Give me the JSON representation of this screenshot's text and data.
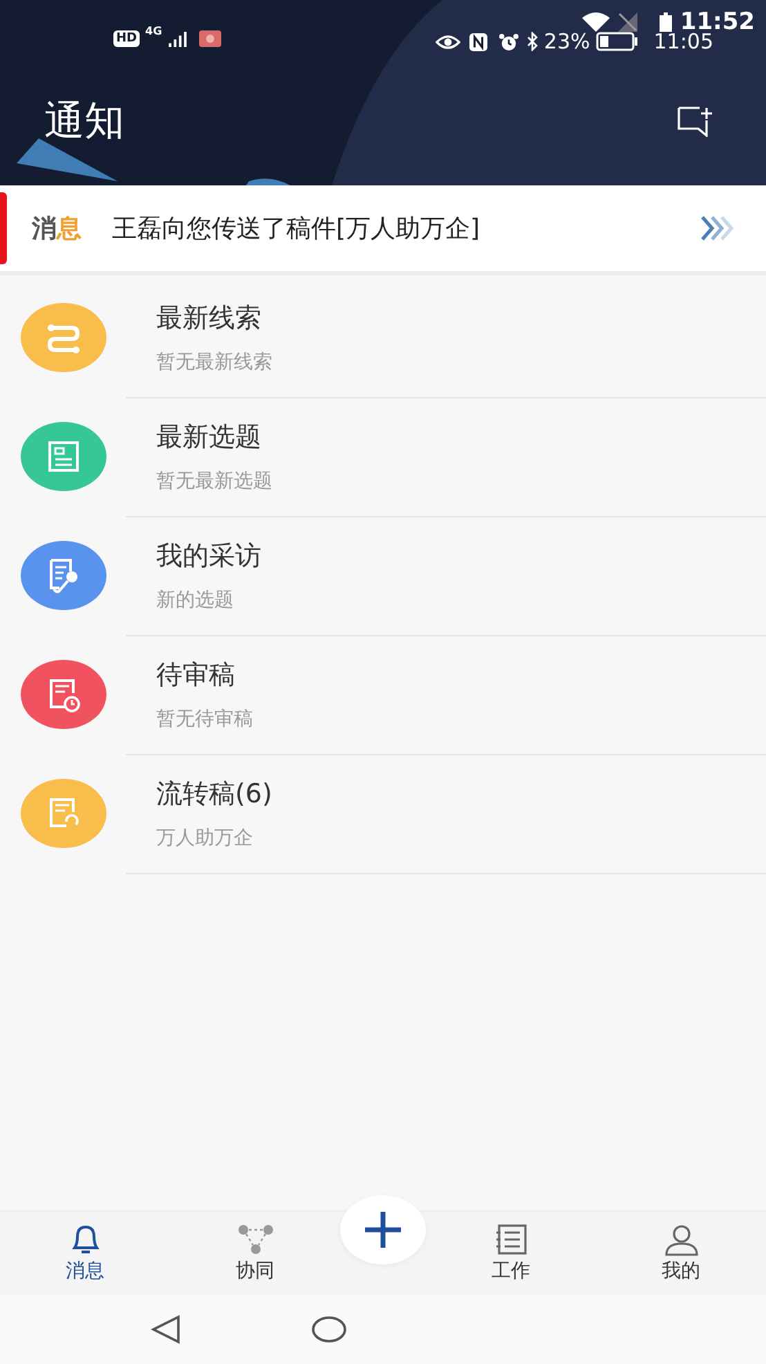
{
  "status_bar": {
    "left_badges": [
      "HD",
      "4G"
    ],
    "battery_percent": "23%",
    "time_primary": "11:52",
    "time_secondary": "11:05"
  },
  "header": {
    "title": "通知"
  },
  "banner": {
    "tag_parts": [
      "消",
      "息"
    ],
    "text": "王磊向您传送了稿件[万人助万企]"
  },
  "items": [
    {
      "title": "最新线索",
      "subtitle": "暂无最新线索",
      "color": "#f8bd4a",
      "kind": "route"
    },
    {
      "title": "最新选题",
      "subtitle": "暂无最新选题",
      "color": "#35c796",
      "kind": "doc"
    },
    {
      "title": "我的采访",
      "subtitle": "新的选题",
      "color": "#5a93ee",
      "kind": "interview"
    },
    {
      "title": "待审稿",
      "subtitle": "暂无待审稿",
      "color": "#f0535f",
      "kind": "review"
    },
    {
      "title": "流转稿(6)",
      "subtitle": "万人助万企",
      "color": "#f8bd4a",
      "kind": "transfer"
    }
  ],
  "tabs": [
    {
      "label": "消息",
      "kind": "bell",
      "selected": true
    },
    {
      "label": "协同",
      "kind": "share",
      "selected": false
    },
    {
      "label": "工作",
      "kind": "list",
      "selected": false
    },
    {
      "label": "我的",
      "kind": "user",
      "selected": false
    }
  ]
}
